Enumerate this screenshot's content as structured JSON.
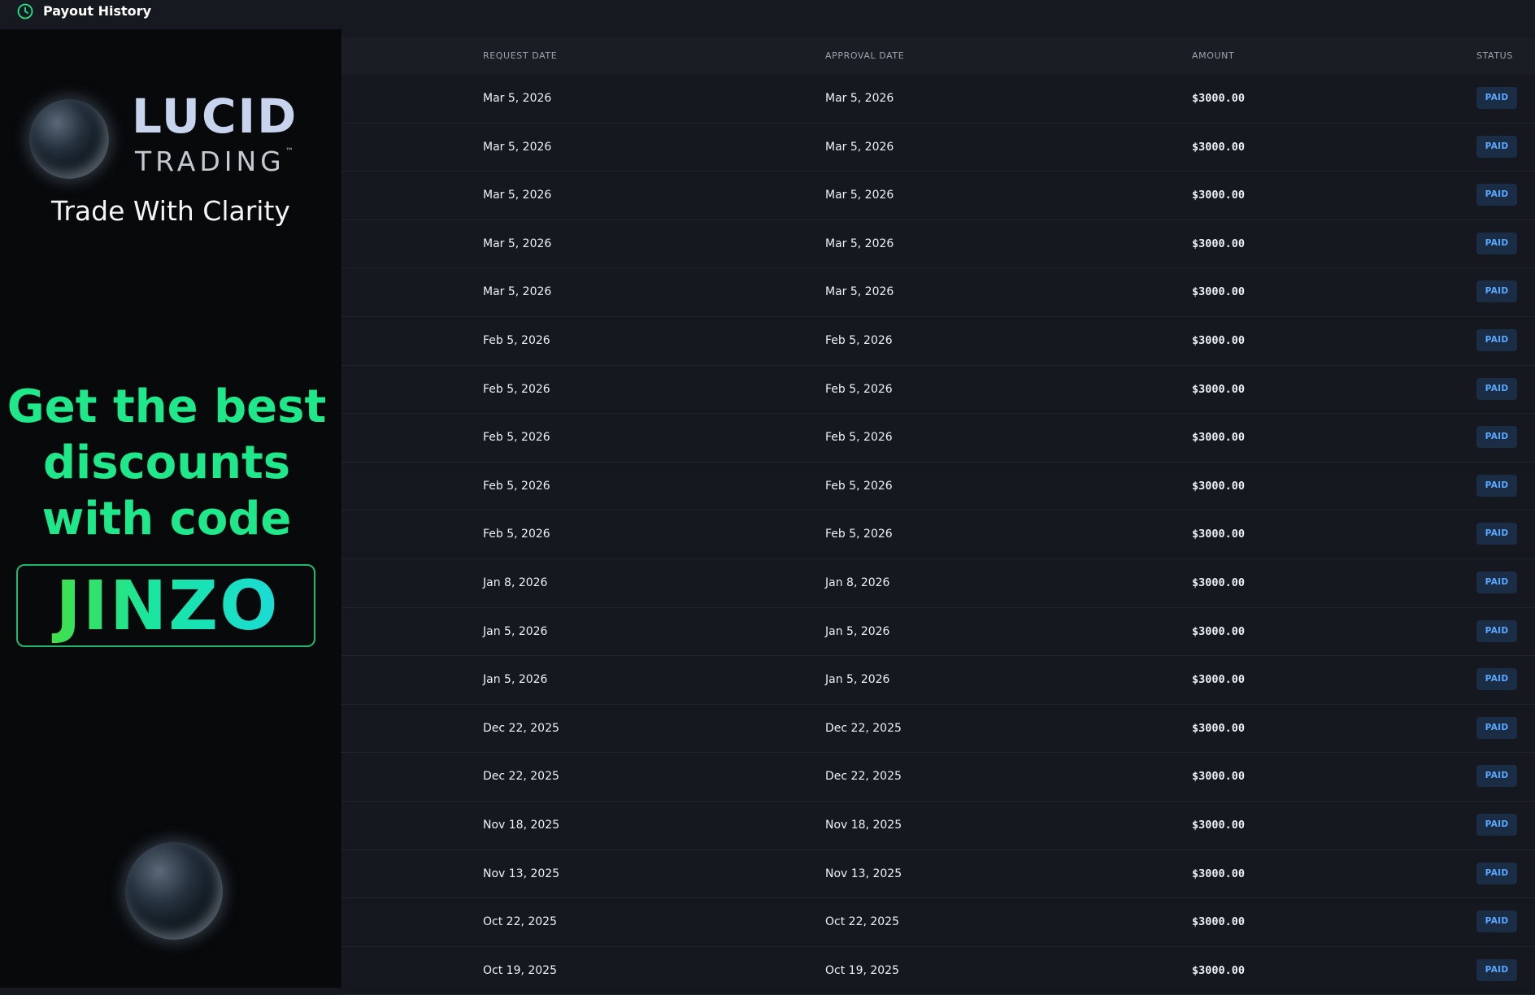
{
  "header": {
    "title": "Payout History",
    "icon": "clock-icon",
    "accent_color": "#1ee88a"
  },
  "ad": {
    "brand_name": "LUCID",
    "brand_sub": "TRADING",
    "trademark": "™",
    "tagline": "Trade With Clarity",
    "promo_line1": "Get the best",
    "promo_line2": "discounts",
    "promo_line3": "with code",
    "promo_code": "JINZO",
    "promo_color": "#1ee88a"
  },
  "table": {
    "columns": {
      "request_date": "REQUEST DATE",
      "approval_date": "APPROVAL DATE",
      "amount": "AMOUNT",
      "status": "STATUS"
    },
    "rows": [
      {
        "request_date": "Mar 5, 2026",
        "approval_date": "Mar 5, 2026",
        "amount": "$3000.00",
        "status": "PAID"
      },
      {
        "request_date": "Mar 5, 2026",
        "approval_date": "Mar 5, 2026",
        "amount": "$3000.00",
        "status": "PAID"
      },
      {
        "request_date": "Mar 5, 2026",
        "approval_date": "Mar 5, 2026",
        "amount": "$3000.00",
        "status": "PAID"
      },
      {
        "request_date": "Mar 5, 2026",
        "approval_date": "Mar 5, 2026",
        "amount": "$3000.00",
        "status": "PAID"
      },
      {
        "request_date": "Mar 5, 2026",
        "approval_date": "Mar 5, 2026",
        "amount": "$3000.00",
        "status": "PAID"
      },
      {
        "request_date": "Feb 5, 2026",
        "approval_date": "Feb 5, 2026",
        "amount": "$3000.00",
        "status": "PAID"
      },
      {
        "request_date": "Feb 5, 2026",
        "approval_date": "Feb 5, 2026",
        "amount": "$3000.00",
        "status": "PAID"
      },
      {
        "request_date": "Feb 5, 2026",
        "approval_date": "Feb 5, 2026",
        "amount": "$3000.00",
        "status": "PAID"
      },
      {
        "request_date": "Feb 5, 2026",
        "approval_date": "Feb 5, 2026",
        "amount": "$3000.00",
        "status": "PAID"
      },
      {
        "request_date": "Feb 5, 2026",
        "approval_date": "Feb 5, 2026",
        "amount": "$3000.00",
        "status": "PAID"
      },
      {
        "request_date": "Jan 8, 2026",
        "approval_date": "Jan 8, 2026",
        "amount": "$3000.00",
        "status": "PAID"
      },
      {
        "request_date": "Jan 5, 2026",
        "approval_date": "Jan 5, 2026",
        "amount": "$3000.00",
        "status": "PAID"
      },
      {
        "request_date": "Jan 5, 2026",
        "approval_date": "Jan 5, 2026",
        "amount": "$3000.00",
        "status": "PAID"
      },
      {
        "request_date": "Dec 22, 2025",
        "approval_date": "Dec 22, 2025",
        "amount": "$3000.00",
        "status": "PAID"
      },
      {
        "request_date": "Dec 22, 2025",
        "approval_date": "Dec 22, 2025",
        "amount": "$3000.00",
        "status": "PAID"
      },
      {
        "request_date": "Nov 18, 2025",
        "approval_date": "Nov 18, 2025",
        "amount": "$3000.00",
        "status": "PAID"
      },
      {
        "request_date": "Nov 13, 2025",
        "approval_date": "Nov 13, 2025",
        "amount": "$3000.00",
        "status": "PAID"
      },
      {
        "request_date": "Oct 22, 2025",
        "approval_date": "Oct 22, 2025",
        "amount": "$3000.00",
        "status": "PAID"
      },
      {
        "request_date": "Oct 19, 2025",
        "approval_date": "Oct 19, 2025",
        "amount": "$3000.00",
        "status": "PAID"
      }
    ]
  }
}
